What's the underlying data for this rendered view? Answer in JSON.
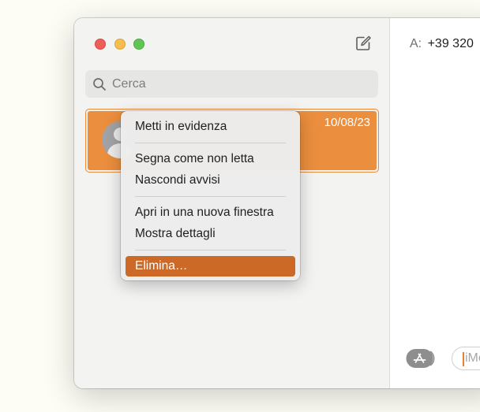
{
  "sidebar": {
    "search": {
      "placeholder": "Cerca"
    },
    "conversations": [
      {
        "date": "10/08/23"
      }
    ]
  },
  "detail": {
    "to_label": "A:",
    "to_value": "+39 320",
    "input_placeholder": "iMessage"
  },
  "context_menu": {
    "items": [
      {
        "label": "Metti in evidenza"
      },
      {
        "label": "Segna come non letta"
      },
      {
        "label": "Nascondi avvisi"
      },
      {
        "label": "Apri in una nuova finestra"
      },
      {
        "label": "Mostra dettagli"
      },
      {
        "label": "Elimina…",
        "selected": true
      }
    ]
  },
  "colors": {
    "accent": "#eb8e3d",
    "selection": "#cc6926",
    "close": "#ee5f5a",
    "minimize": "#f5be4f",
    "maximize": "#5fc554"
  },
  "icons": {
    "compose": "compose-icon",
    "search": "search-icon",
    "avatar": "person-icon",
    "app_store": "app-store-icon"
  }
}
